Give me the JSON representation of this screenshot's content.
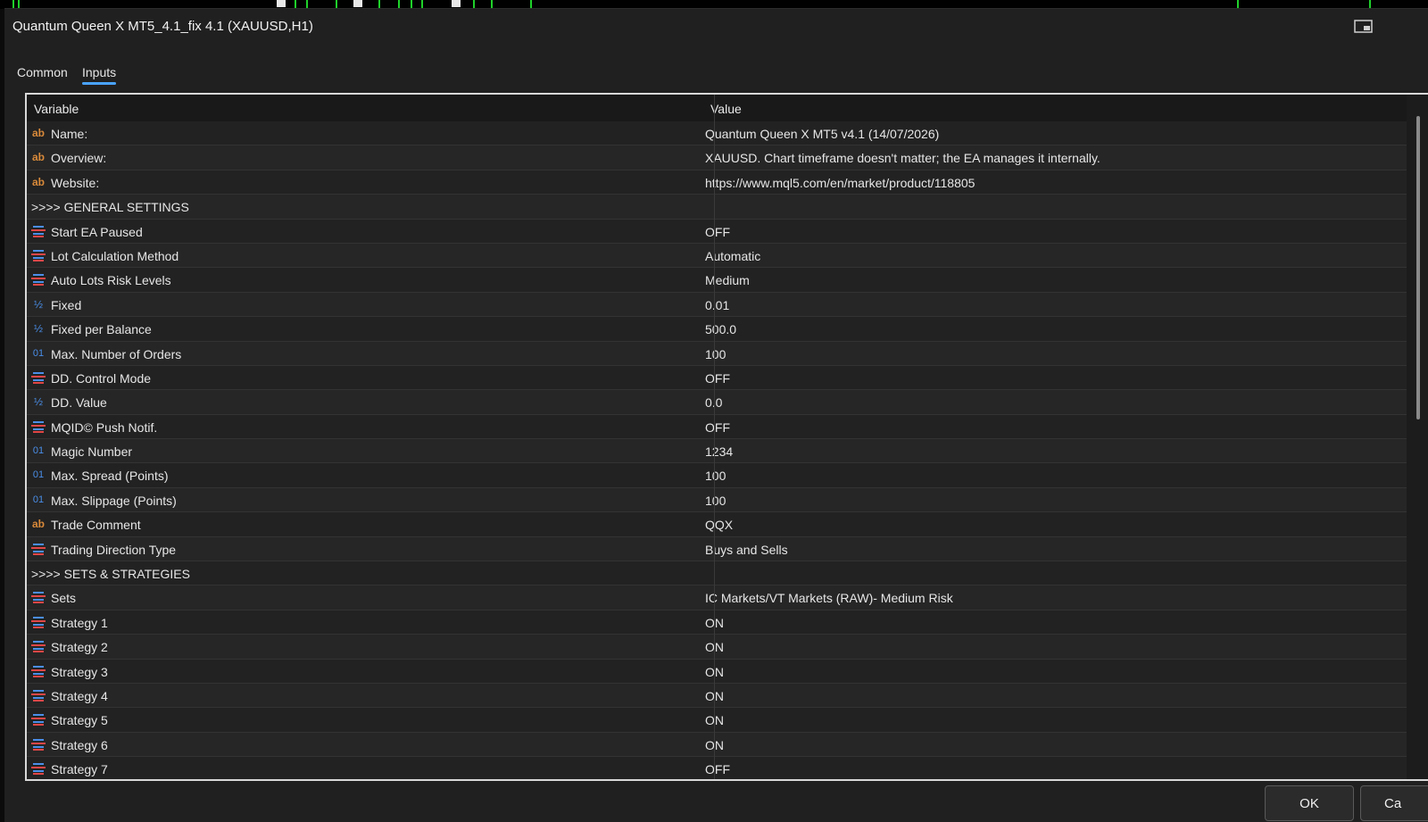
{
  "window": {
    "title": "Quantum Queen X MT5_4.1_fix 4.1 (XAUUSD,H1)"
  },
  "tabs": [
    {
      "label": "Common",
      "active": false
    },
    {
      "label": "Inputs",
      "active": true
    }
  ],
  "grid": {
    "headers": {
      "variable": "Variable",
      "value": "Value"
    },
    "rows": [
      {
        "type": "string",
        "icon": "ab",
        "variable": "Name:",
        "value": "Quantum Queen X MT5 v4.1 (14/07/2026)"
      },
      {
        "type": "string",
        "icon": "ab",
        "variable": "Overview:",
        "value": "XAUUSD. Chart timeframe doesn't matter; the EA manages it internally."
      },
      {
        "type": "string",
        "icon": "ab",
        "variable": "Website:",
        "value": "https://www.mql5.com/en/market/product/118805"
      },
      {
        "type": "section",
        "icon": "",
        "variable": ">>>> GENERAL SETTINGS",
        "value": ""
      },
      {
        "type": "enum",
        "icon": "enum",
        "variable": "Start EA Paused",
        "value": "OFF"
      },
      {
        "type": "enum",
        "icon": "enum",
        "variable": "Lot Calculation Method",
        "value": "Automatic"
      },
      {
        "type": "enum",
        "icon": "enum",
        "variable": "Auto Lots Risk Levels",
        "value": "Medium"
      },
      {
        "type": "double",
        "icon": "½",
        "variable": "Fixed",
        "value": "0.01"
      },
      {
        "type": "double",
        "icon": "½",
        "variable": "Fixed per Balance",
        "value": "500.0"
      },
      {
        "type": "int",
        "icon": "01",
        "variable": "Max. Number of Orders",
        "value": "100"
      },
      {
        "type": "enum",
        "icon": "enum",
        "variable": "DD. Control Mode",
        "value": "OFF"
      },
      {
        "type": "double",
        "icon": "½",
        "variable": "DD. Value",
        "value": "0.0"
      },
      {
        "type": "enum",
        "icon": "enum",
        "variable": "MQID© Push Notif.",
        "value": "OFF"
      },
      {
        "type": "int",
        "icon": "01",
        "variable": "Magic Number",
        "value": "1234"
      },
      {
        "type": "int",
        "icon": "01",
        "variable": "Max. Spread (Points)",
        "value": "100"
      },
      {
        "type": "int",
        "icon": "01",
        "variable": "Max. Slippage (Points)",
        "value": "100"
      },
      {
        "type": "string",
        "icon": "ab",
        "variable": "Trade Comment",
        "value": "QQX"
      },
      {
        "type": "enum",
        "icon": "enum",
        "variable": "Trading Direction Type",
        "value": "Buys and Sells"
      },
      {
        "type": "section",
        "icon": "",
        "variable": ">>>> SETS & STRATEGIES",
        "value": ""
      },
      {
        "type": "enum",
        "icon": "enum",
        "variable": "Sets",
        "value": "IC Markets/VT Markets (RAW)- Medium Risk"
      },
      {
        "type": "enum",
        "icon": "enum",
        "variable": "Strategy 1",
        "value": "ON"
      },
      {
        "type": "enum",
        "icon": "enum",
        "variable": "Strategy 2",
        "value": "ON"
      },
      {
        "type": "enum",
        "icon": "enum",
        "variable": "Strategy 3",
        "value": "ON"
      },
      {
        "type": "enum",
        "icon": "enum",
        "variable": "Strategy 4",
        "value": "ON"
      },
      {
        "type": "enum",
        "icon": "enum",
        "variable": "Strategy 5",
        "value": "ON"
      },
      {
        "type": "enum",
        "icon": "enum",
        "variable": "Strategy 6",
        "value": "ON"
      },
      {
        "type": "enum",
        "icon": "enum",
        "variable": "Strategy 7",
        "value": "OFF"
      }
    ]
  },
  "buttons": {
    "ok": "OK",
    "cancel": "Ca"
  },
  "colors": {
    "accent": "#4aa3ff",
    "string_icon": "#d98a3a",
    "numeric_icon": "#4a8ee8",
    "enum_icon_blue": "#4a8ee8",
    "enum_icon_red": "#e04646"
  }
}
